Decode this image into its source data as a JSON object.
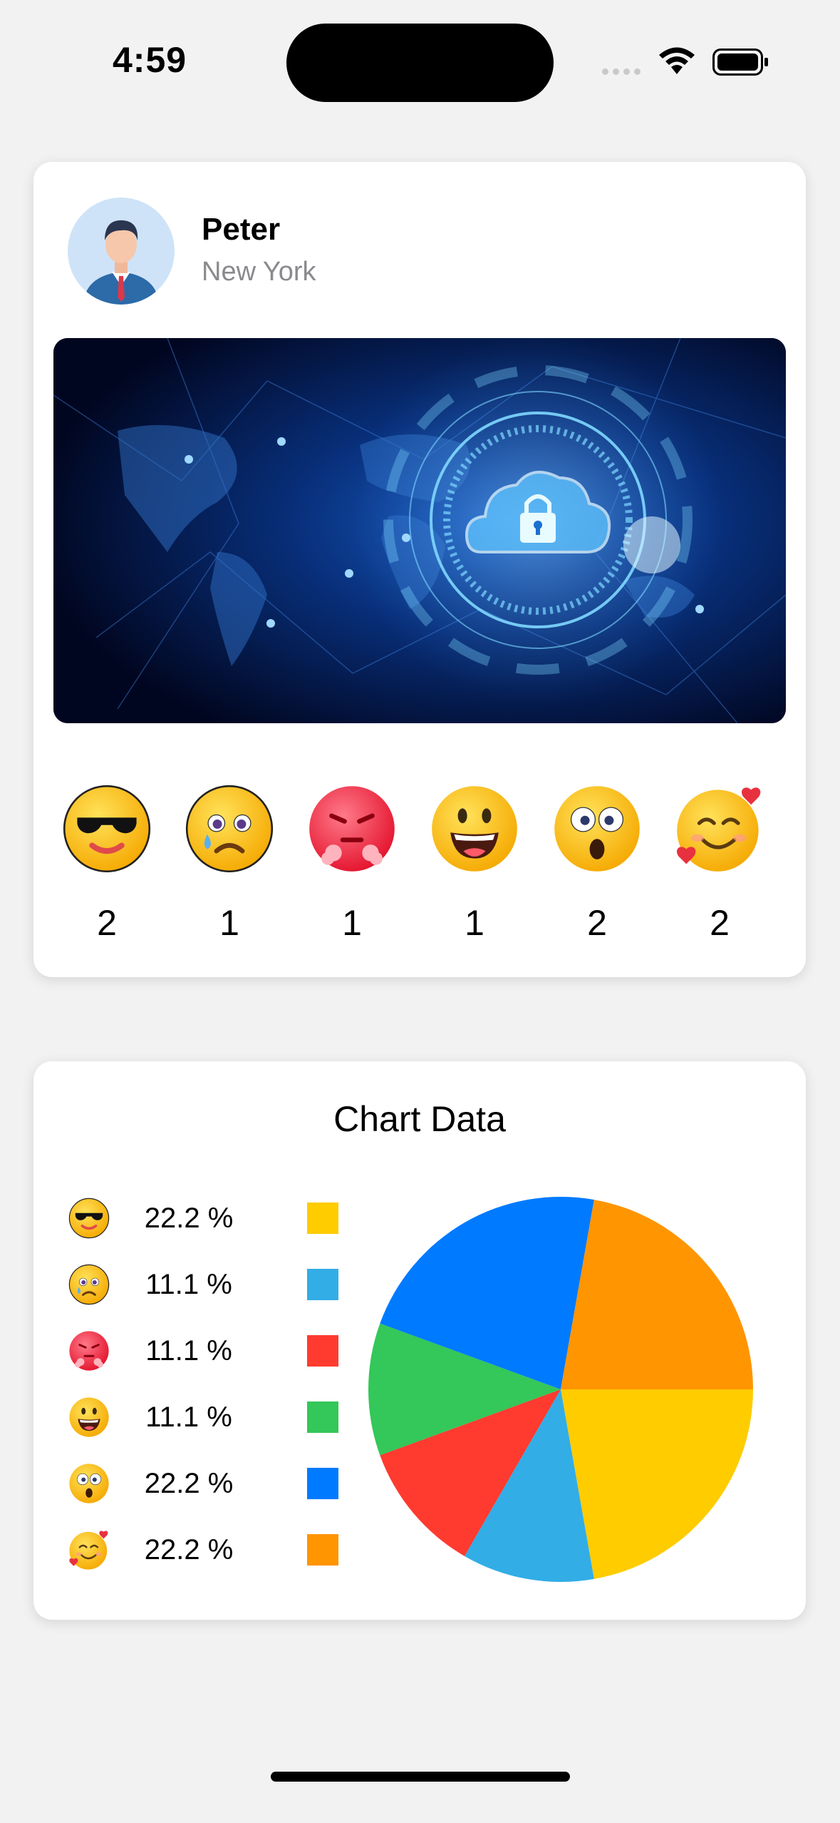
{
  "status_bar": {
    "time": "4:59"
  },
  "post": {
    "user": {
      "name": "Peter",
      "location": "New York"
    },
    "image_icon": "cloud-security-world-map-image",
    "reactions": [
      {
        "icon": "sunglasses-emoji-icon",
        "count": "2"
      },
      {
        "icon": "crying-face-emoji-icon",
        "count": "1"
      },
      {
        "icon": "angry-face-emoji-icon",
        "count": "1"
      },
      {
        "icon": "grinning-face-emoji-icon",
        "count": "1"
      },
      {
        "icon": "astonished-face-emoji-icon",
        "count": "2"
      },
      {
        "icon": "smiling-face-with-hearts-emoji-icon",
        "count": "2"
      }
    ]
  },
  "chart_card": {
    "title": "Chart Data",
    "legend": [
      {
        "icon": "sunglasses-emoji-icon",
        "percent": "22.2 %",
        "color": "#FFCC00"
      },
      {
        "icon": "crying-face-emoji-icon",
        "percent": "11.1 %",
        "color": "#32ADE6"
      },
      {
        "icon": "angry-face-emoji-icon",
        "percent": "11.1 %",
        "color": "#FF3B30"
      },
      {
        "icon": "grinning-face-emoji-icon",
        "percent": "11.1 %",
        "color": "#34C759"
      },
      {
        "icon": "astonished-face-emoji-icon",
        "percent": "22.2 %",
        "color": "#007AFF"
      },
      {
        "icon": "smiling-face-with-hearts-emoji-icon",
        "percent": "22.2 %",
        "color": "#FF9500"
      }
    ]
  },
  "chart_data": {
    "type": "pie",
    "title": "Chart Data",
    "slices": [
      {
        "label": "sunglasses",
        "value": 2,
        "percent": 22.2,
        "color": "#FFCC00"
      },
      {
        "label": "crying",
        "value": 1,
        "percent": 11.1,
        "color": "#32ADE6"
      },
      {
        "label": "angry",
        "value": 1,
        "percent": 11.1,
        "color": "#FF3B30"
      },
      {
        "label": "grinning",
        "value": 1,
        "percent": 11.1,
        "color": "#34C759"
      },
      {
        "label": "astonished",
        "value": 2,
        "percent": 22.2,
        "color": "#007AFF"
      },
      {
        "label": "smiling-hearts",
        "value": 2,
        "percent": 22.2,
        "color": "#FF9500"
      }
    ],
    "start": "3 o'clock",
    "direction": "clockwise"
  }
}
